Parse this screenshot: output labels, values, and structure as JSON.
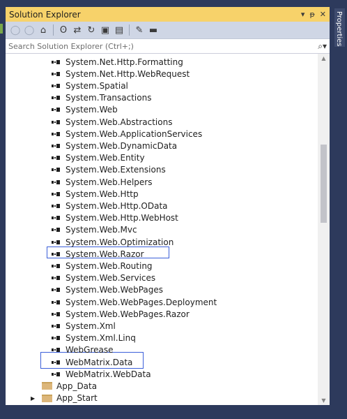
{
  "title": "Solution Explorer",
  "title_icons": {
    "dropdown": "▾",
    "pin": "ᵽ",
    "close": "✕"
  },
  "search_placeholder": "Search Solution Explorer (Ctrl+;)",
  "side_tab": "Properties",
  "items": [
    "System.Net.Http.Formatting",
    "System.Net.Http.WebRequest",
    "System.Spatial",
    "System.Transactions",
    "System.Web",
    "System.Web.Abstractions",
    "System.Web.ApplicationServices",
    "System.Web.DynamicData",
    "System.Web.Entity",
    "System.Web.Extensions",
    "System.Web.Helpers",
    "System.Web.Http",
    "System.Web.Http.OData",
    "System.Web.Http.WebHost",
    "System.Web.Mvc",
    "System.Web.Optimization",
    "System.Web.Razor",
    "System.Web.Routing",
    "System.Web.Services",
    "System.Web.WebPages",
    "System.Web.WebPages.Deployment",
    "System.Web.WebPages.Razor",
    "System.Xml",
    "System.Xml.Linq",
    "WebGrease",
    "WebMatrix.Data",
    "WebMatrix.WebData"
  ],
  "folders": [
    "App_Data",
    "App_Start"
  ],
  "colors": {
    "accent_titlebar": "#f7d26a",
    "frame": "#2d3a5c",
    "highlight_box": "#3b5fd9"
  }
}
